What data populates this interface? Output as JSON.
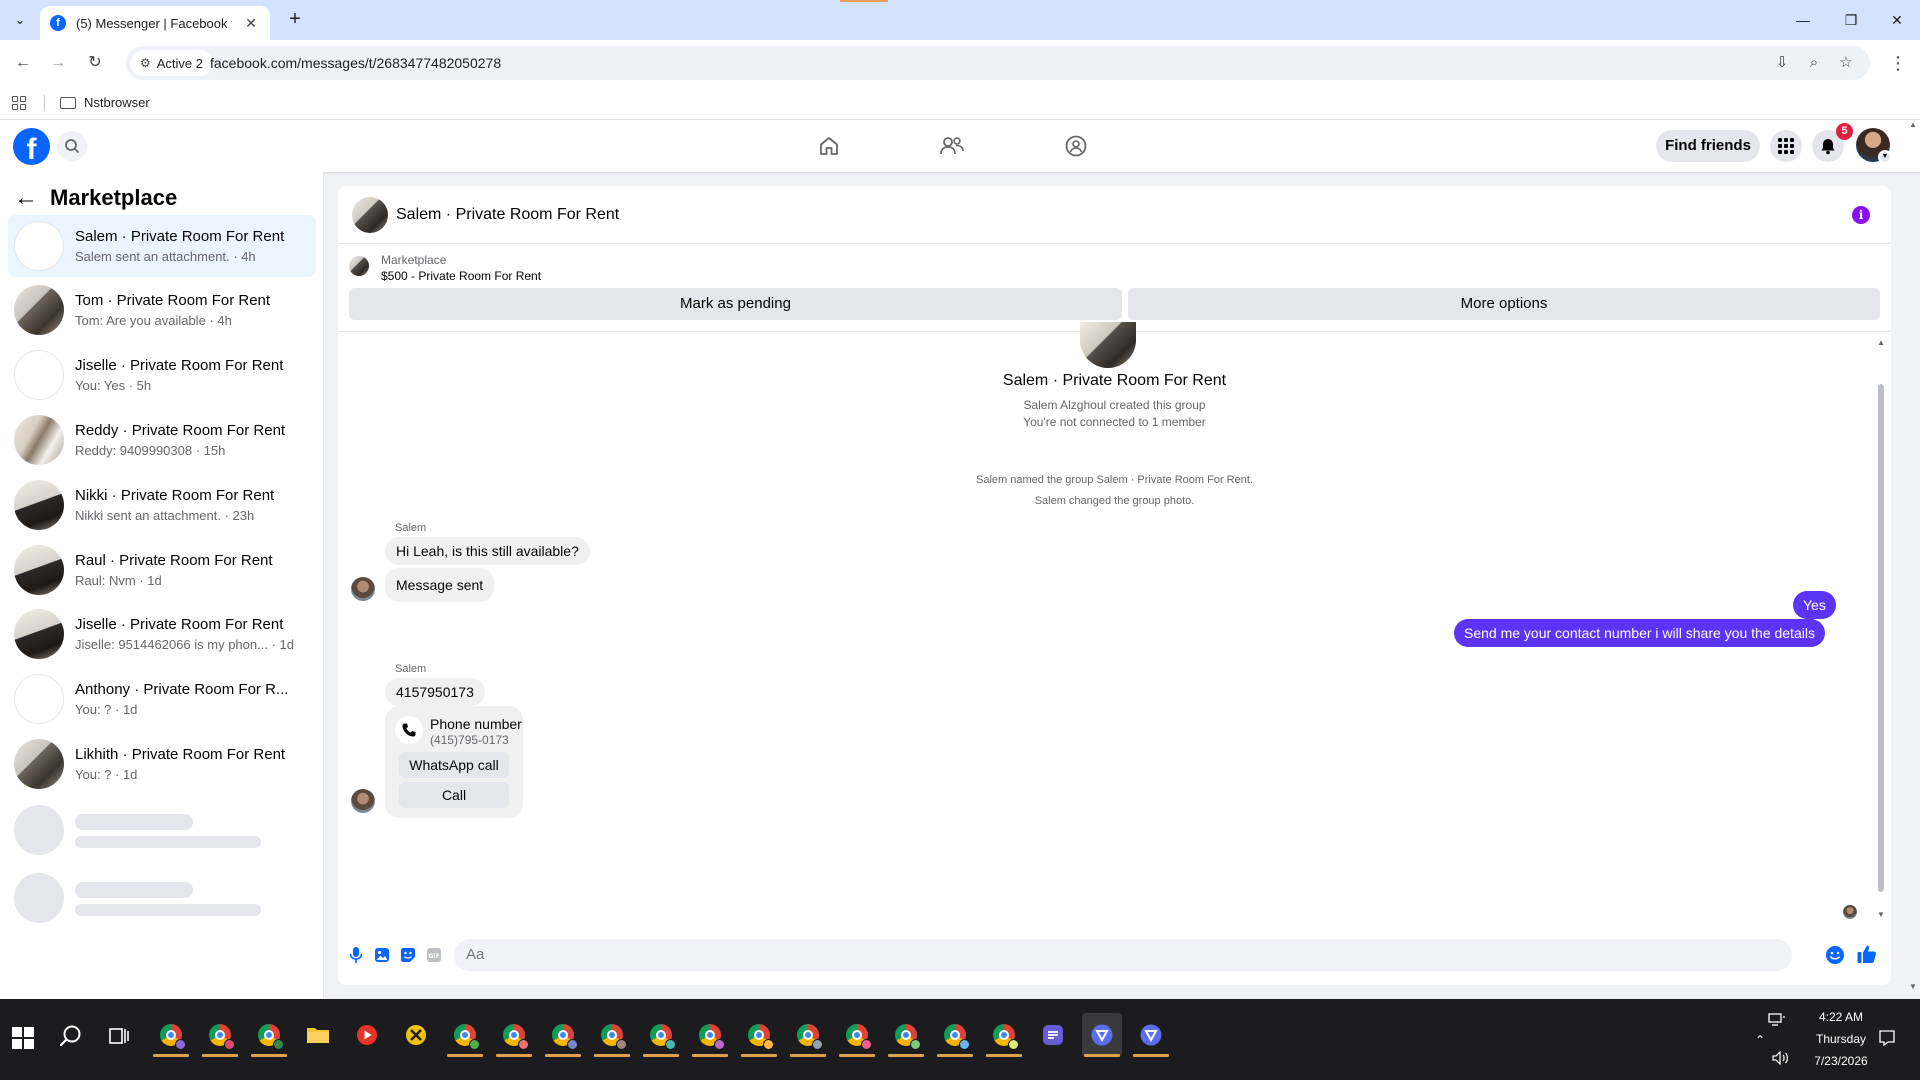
{
  "browser": {
    "tab_title": "(5) Messenger | Facebook",
    "url": "facebook.com/messages/t/2683477482050278",
    "site_chip": "Active 2",
    "bookmark_folder": "Nstbrowser"
  },
  "fb_nav": {
    "find_friends": "Find friends",
    "notification_count": "5"
  },
  "sidebar": {
    "title": "Marketplace",
    "conversations": [
      {
        "name": "Salem · Private Room For Rent",
        "snippet": "Salem sent an attachment. · 4h"
      },
      {
        "name": "Tom · Private Room For Rent",
        "snippet": "Tom: Are you available · 4h"
      },
      {
        "name": "Jiselle · Private Room For Rent",
        "snippet": "You: Yes · 5h"
      },
      {
        "name": "Reddy · Private Room For Rent",
        "snippet": "Reddy: 9409990308 · 15h"
      },
      {
        "name": "Nikki · Private Room For Rent",
        "snippet": "Nikki sent an attachment. · 23h"
      },
      {
        "name": "Raul · Private Room For Rent",
        "snippet": "Raul: Nvm · 1d"
      },
      {
        "name": "Jiselle · Private Room For Rent",
        "snippet": "Jiselle: 9514462066 is my phon... · 1d"
      },
      {
        "name": "Anthony · Private Room For R...",
        "snippet": "You: ? · 1d"
      },
      {
        "name": "Likhith · Private Room For Rent",
        "snippet": "You: ? · 1d"
      }
    ]
  },
  "chat": {
    "title": "Salem · Private Room For Rent",
    "marketplace_label": "Marketplace",
    "listing": "$500 - Private Room For Rent",
    "mark_pending": "Mark as pending",
    "more_options": "More options",
    "group_name": "Salem · Private Room For Rent",
    "created_by": "Salem Alzghoul created this group",
    "not_connected": "You're not connected to 1 member",
    "event_named": "Salem named the group Salem · Private Room For Rent.",
    "event_photo": "Salem changed the group photo.",
    "sender_1": "Salem",
    "msg_1": "Hi Leah, is this still available?",
    "msg_2": "Message sent",
    "out_1": "Yes",
    "out_2": "Send me your contact number i will share you the details",
    "sender_2": "Salem",
    "msg_3": "4157950173",
    "phone_card_title": "Phone number",
    "phone_card_number": "(415)795-0173",
    "whatsapp_call": "WhatsApp call",
    "call": "Call",
    "composer_placeholder": "Aa"
  },
  "taskbar": {
    "time": "4:22 AM",
    "day": "Thursday",
    "date": "7/23/2026"
  },
  "colors": {
    "fb_blue": "#0866ff",
    "outgoing_bubble": "#5b34f5",
    "info_icon": "#8b10f0",
    "notification_badge": "#e41e3f"
  }
}
